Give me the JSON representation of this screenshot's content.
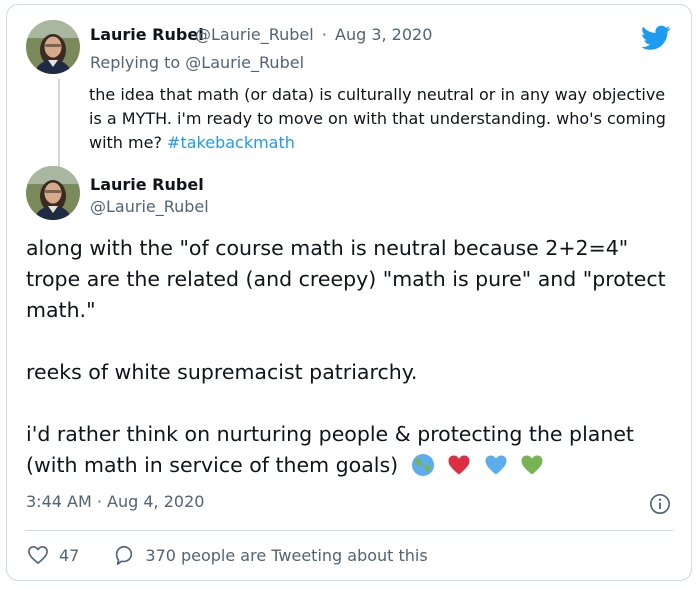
{
  "colors": {
    "accent": "#1d9bf0",
    "text": "#0f1419",
    "muted": "#536471",
    "border": "#cfd9de",
    "heart": "#e0245e",
    "blue_heart": "#5dadec",
    "green_heart": "#77b255"
  },
  "quoted_tweet": {
    "author_name": "Laurie Rubel",
    "author_handle": "@Laurie_Rubel",
    "separator": "·",
    "date": "Aug 3, 2020",
    "replying_to_label": "Replying to",
    "replying_to_handle": "@Laurie_Rubel",
    "text": "the idea that math (or data) is culturally neutral or in any way objective is a MYTH. i'm ready to move on with that understanding. who's coming with me?",
    "hashtag": "#takebackmath"
  },
  "main_tweet": {
    "author_name": "Laurie Rubel",
    "author_handle": "@Laurie_Rubel",
    "lines": [
      "along with the \"of course math is neutral because 2+2=4\"",
      "trope are the related (and creepy) \"math is pure\" and \"protect",
      "math.\"",
      "",
      "reeks of white supremacist patriarchy.",
      "",
      "i'd rather think on nurturing people & protecting the planet",
      "(with math in service of them goals)"
    ],
    "emojis": [
      "globe-icon",
      "red-heart-icon",
      "blue-heart-icon",
      "green-heart-icon"
    ],
    "timestamp": "3:44 AM · Aug 4, 2020",
    "like_count": "47",
    "conversation_text": "370 people are Tweeting about this"
  },
  "icons": {
    "logo": "twitter-bird-icon",
    "info": "info-icon",
    "like": "heart-outline-icon",
    "reply": "speech-bubble-icon"
  }
}
